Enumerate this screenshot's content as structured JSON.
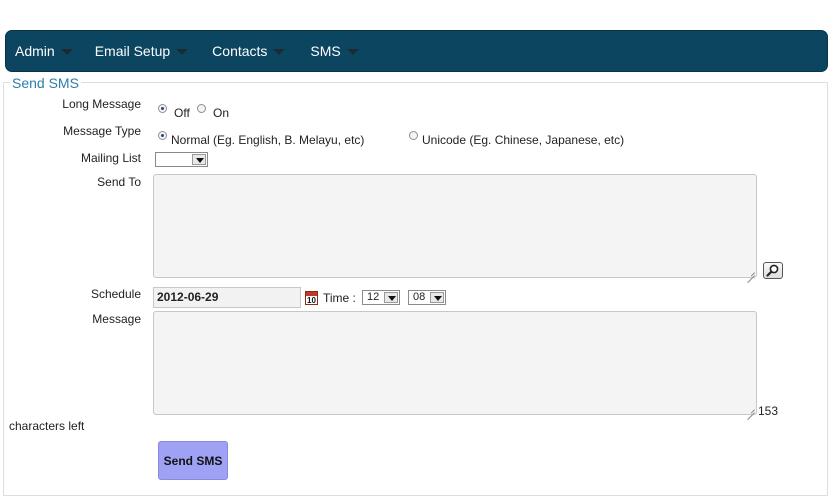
{
  "nav": {
    "items": [
      {
        "label": "Admin"
      },
      {
        "label": "Email Setup"
      },
      {
        "label": "Contacts"
      },
      {
        "label": "SMS"
      }
    ]
  },
  "form": {
    "legend": "Send SMS",
    "long_message": {
      "label": "Long Message",
      "options": [
        {
          "label": "Off",
          "checked": true
        },
        {
          "label": "On",
          "checked": false
        }
      ]
    },
    "message_type": {
      "label": "Message Type",
      "options": [
        {
          "label": "Normal (Eg. English, B. Melayu, etc)",
          "checked": true
        },
        {
          "label": "Unicode (Eg. Chinese, Japanese, etc)",
          "checked": false
        }
      ]
    },
    "mailing_list": {
      "label": "Mailing List",
      "value": ""
    },
    "send_to": {
      "label": "Send To",
      "value": ""
    },
    "schedule": {
      "label": "Schedule",
      "date": "2012-06-29",
      "time_label": "Time :",
      "hour": "12",
      "minute": "08"
    },
    "message": {
      "label": "Message",
      "value": "",
      "chars_left": "153",
      "chars_left_label": "characters left"
    },
    "send_button": "Send SMS"
  },
  "icons": {
    "lookup": "magnifier-icon",
    "calendar": "calendar-icon",
    "nav_caret": "caret-down-icon"
  },
  "colors": {
    "navbar": "#0b4560",
    "legend": "#2a7fa8",
    "send_button": "#9fa1f4"
  }
}
